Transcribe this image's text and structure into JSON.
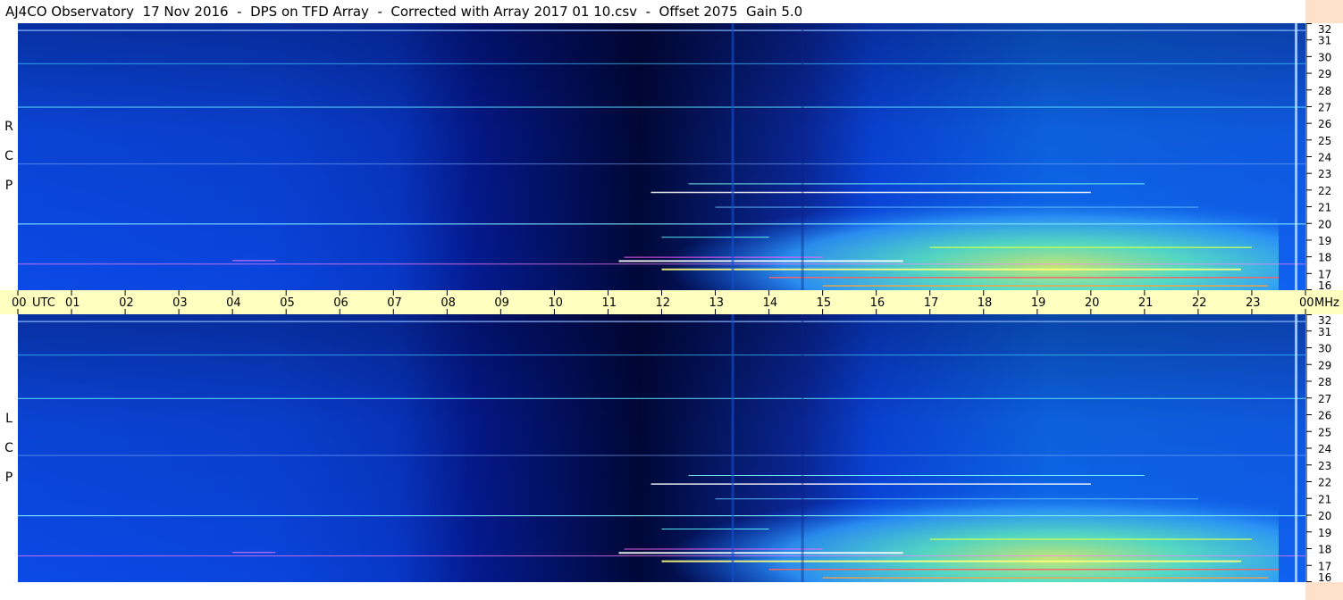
{
  "title": "AJ4CO Observatory  17 Nov 2016  -  DPS on TFD Array  -  Corrected with Array 2017 01 10.csv  -  Offset 2075  Gain 5.0",
  "panels": {
    "rcp_letters": [
      "R",
      "C",
      "P"
    ],
    "lcp_letters": [
      "L",
      "C",
      "P"
    ]
  },
  "utc_axis": {
    "unit_label": "UTC",
    "freq_unit_label": "MHz",
    "hour_labels": [
      "00",
      "01",
      "02",
      "03",
      "04",
      "05",
      "06",
      "07",
      "08",
      "09",
      "10",
      "11",
      "12",
      "13",
      "14",
      "15",
      "16",
      "17",
      "18",
      "19",
      "20",
      "21",
      "22",
      "23",
      "00"
    ]
  },
  "freq_axis": {
    "labels": [
      "32",
      "31",
      "30",
      "29",
      "28",
      "27",
      "26",
      "25",
      "24",
      "23",
      "22",
      "21",
      "20",
      "19",
      "18",
      "17",
      "16"
    ]
  },
  "colors": {
    "background_blue": "#0a3cd8",
    "night_dark": "#000020",
    "axis_bar": "#ffffc0",
    "right_panel": "#ffe0c8",
    "emission_cyan": "#40e0ff",
    "emission_yellow": "#e8ff60"
  },
  "chart_data": [
    {
      "type": "heatmap",
      "polarization": "RCP",
      "x_range_utc_hours": [
        0,
        24
      ],
      "y_range_mhz": [
        16,
        32
      ],
      "dark_band_utc_hours": [
        8.5,
        14.7
      ],
      "emission_region_utc_hours": [
        11.5,
        23.5
      ],
      "emission_region_mhz": [
        16,
        23
      ]
    },
    {
      "type": "heatmap",
      "polarization": "LCP",
      "x_range_utc_hours": [
        0,
        24
      ],
      "y_range_mhz": [
        16,
        32
      ],
      "dark_band_utc_hours": [
        8.5,
        14.7
      ],
      "emission_region_utc_hours": [
        11.5,
        23.5
      ],
      "emission_region_mhz": [
        16,
        23
      ]
    }
  ]
}
